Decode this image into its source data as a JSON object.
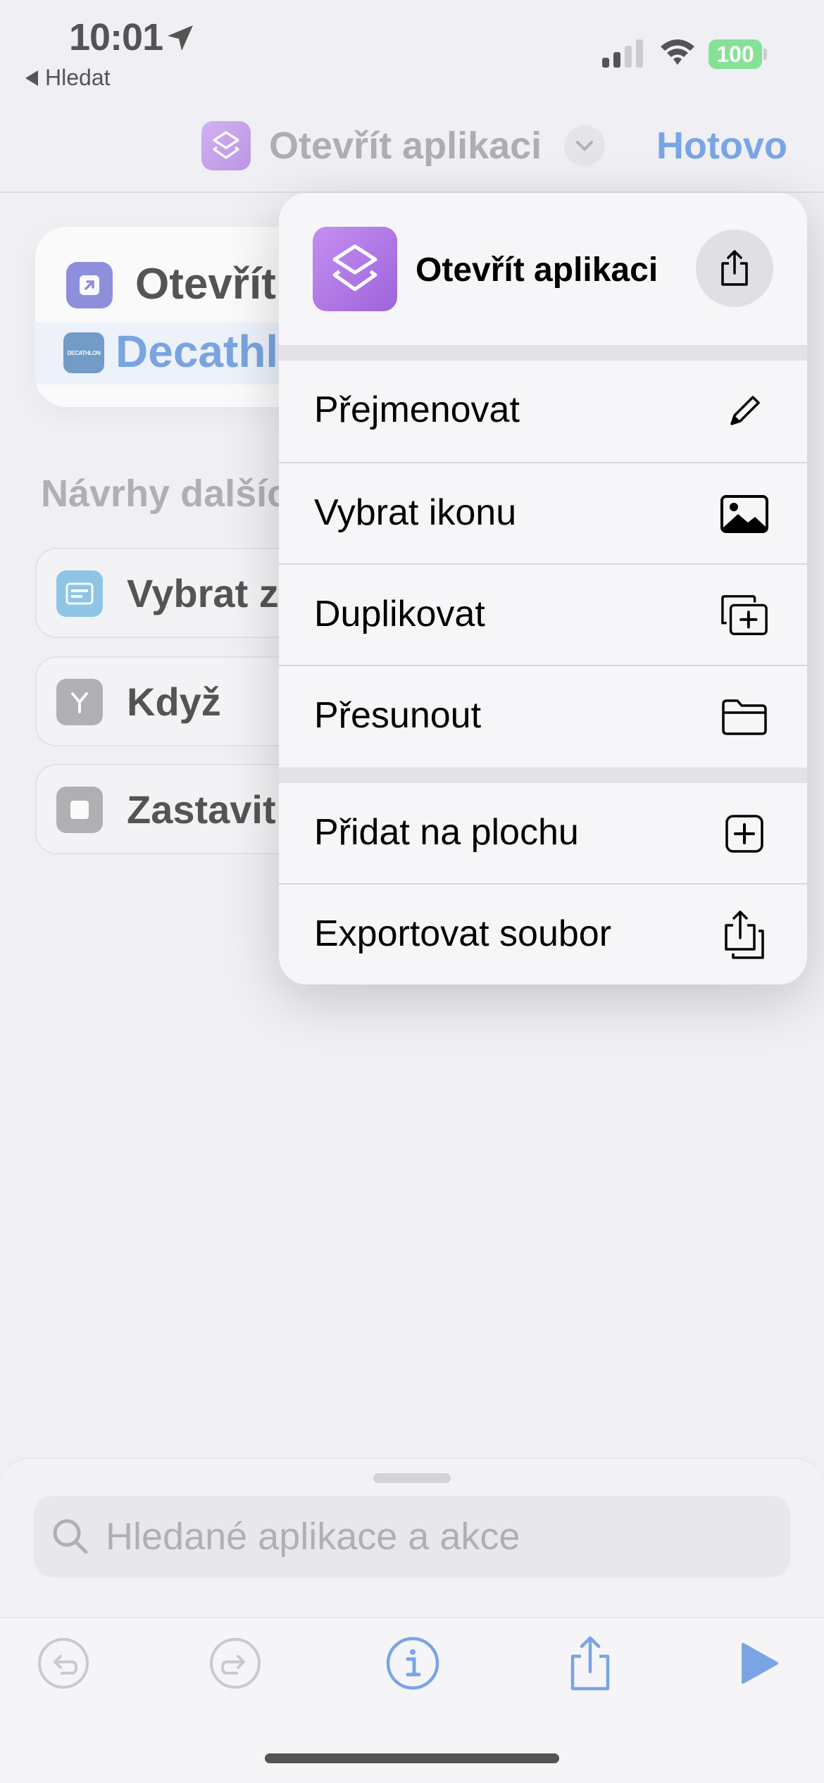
{
  "status_bar": {
    "time": "10:01",
    "back_label": "Hledat",
    "battery": "100"
  },
  "nav": {
    "title": "Otevřít aplikaci",
    "done_label": "Hotovo"
  },
  "action_card": {
    "action_label": "Otevřít",
    "app_name": "Decathlon",
    "app_badge_text": "DECATHLON"
  },
  "suggestions": {
    "title": "Návrhy dalších",
    "items": [
      {
        "label": "Vybrat z",
        "icon": "menu-list-icon",
        "color": "#5aaee0"
      },
      {
        "label": "Když",
        "icon": "branch-icon",
        "color": "#8e8e93"
      },
      {
        "label": "Zastavit",
        "icon": "stop-icon",
        "color": "#8e8e93"
      }
    ]
  },
  "menu": {
    "title": "Otevřít aplikaci",
    "items": [
      {
        "label": "Přejmenovat",
        "icon": "pencil-icon"
      },
      {
        "label": "Vybrat ikonu",
        "icon": "photo-icon"
      },
      {
        "label": "Duplikovat",
        "icon": "duplicate-icon"
      },
      {
        "label": "Přesunout",
        "icon": "folder-icon"
      },
      {
        "label": "Přidat na plochu",
        "icon": "add-square-icon"
      },
      {
        "label": "Exportovat soubor",
        "icon": "export-file-icon"
      }
    ]
  },
  "search": {
    "placeholder": "Hledané aplikace a akce"
  },
  "toolbar": {
    "icons": [
      "undo-icon",
      "redo-icon",
      "info-icon",
      "share-icon",
      "play-icon"
    ]
  },
  "colors": {
    "accent": "#3b7ddd",
    "shortcuts_purple": "#b07ae6",
    "open_app_indigo": "#5a59cf",
    "battery_green": "#4cd964"
  }
}
